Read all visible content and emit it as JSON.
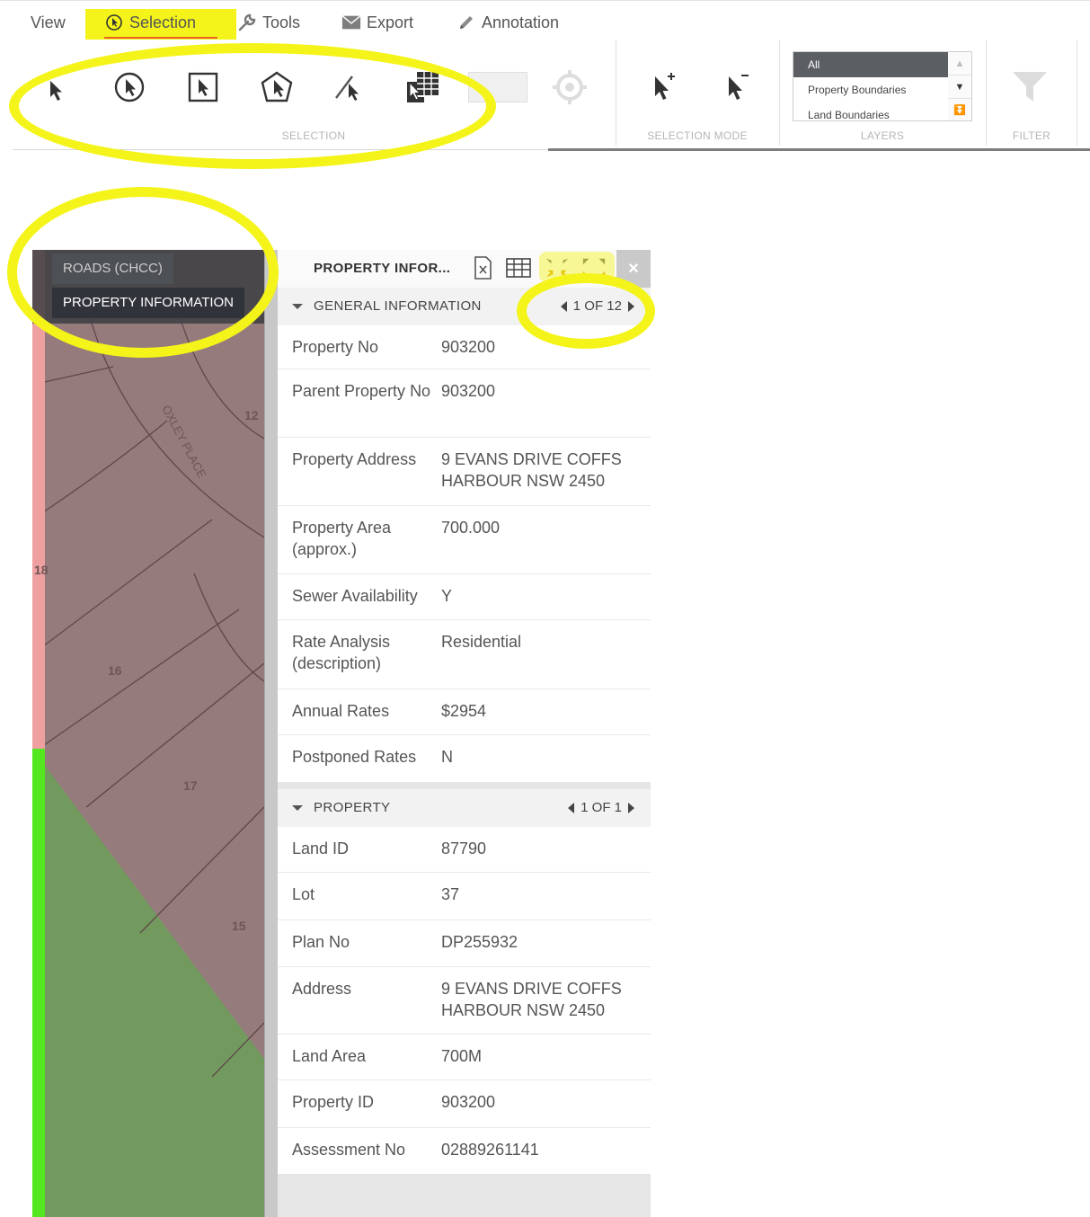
{
  "menu": {
    "tabs": [
      {
        "label": "View",
        "icon": null
      },
      {
        "label": "Selection",
        "icon": "cursor-circle-icon"
      },
      {
        "label": "Tools",
        "icon": "wrench-icon"
      },
      {
        "label": "Export",
        "icon": "envelope-icon"
      },
      {
        "label": "Annotation",
        "icon": "pencil-icon"
      }
    ],
    "active": "Selection",
    "accent_color": "#e9651e"
  },
  "ribbon": {
    "groups": {
      "selection": "SELECTION",
      "selection_mode": "SELECTION MODE",
      "layers": "LAYERS",
      "filter": "FILTER"
    },
    "selection_tools": [
      "point-select-icon",
      "circle-select-icon",
      "rectangle-select-icon",
      "polygon-select-icon",
      "line-select-icon",
      "table-select-icon",
      "color-swatch",
      "crosshair-icon"
    ],
    "mode_tools": [
      "add-to-selection-icon",
      "remove-from-selection-icon"
    ],
    "layers_options": [
      "All",
      "Property Boundaries",
      "Land Boundaries"
    ],
    "layers_selected": "All"
  },
  "map": {
    "layer_tabs": [
      "ROADS (CHCC)",
      "PROPERTY INFORMATION"
    ],
    "street_label": "OXLEY PLACE",
    "parcel_numbers": [
      "12",
      "15",
      "16",
      "17",
      "18"
    ],
    "parcel_color": "#957b7b",
    "green_color": "#729a5f"
  },
  "panel": {
    "title": "PROPERTY INFOR...",
    "close": "×",
    "general": {
      "title": "GENERAL INFORMATION",
      "pager": "1 OF 12",
      "rows": [
        {
          "label": "Property No",
          "value": "903200"
        },
        {
          "label": "Parent Property No",
          "value": "903200"
        },
        {
          "label": "Property Address",
          "value": "9 EVANS DRIVE COFFS HARBOUR NSW 2450"
        },
        {
          "label": "Property Area (approx.)",
          "value": "700.000"
        },
        {
          "label": "Sewer Availability",
          "value": "Y"
        },
        {
          "label": "Rate Analysis (description)",
          "value": "Residential"
        },
        {
          "label": "Annual Rates",
          "value": "$2954"
        },
        {
          "label": "Postponed Rates",
          "value": "N"
        }
      ]
    },
    "property": {
      "title": "PROPERTY",
      "pager": "1 OF 1",
      "rows": [
        {
          "label": "Land ID",
          "value": "87790"
        },
        {
          "label": "Lot",
          "value": "37"
        },
        {
          "label": "Plan No",
          "value": "DP255932"
        },
        {
          "label": "Address",
          "value": "9 EVANS DRIVE COFFS HARBOUR NSW 2450"
        },
        {
          "label": "Land Area",
          "value": "700M"
        },
        {
          "label": "Property ID",
          "value": "903200"
        },
        {
          "label": "Assessment No",
          "value": "02889261141"
        }
      ]
    }
  },
  "highlight_color": "#f4f41a"
}
